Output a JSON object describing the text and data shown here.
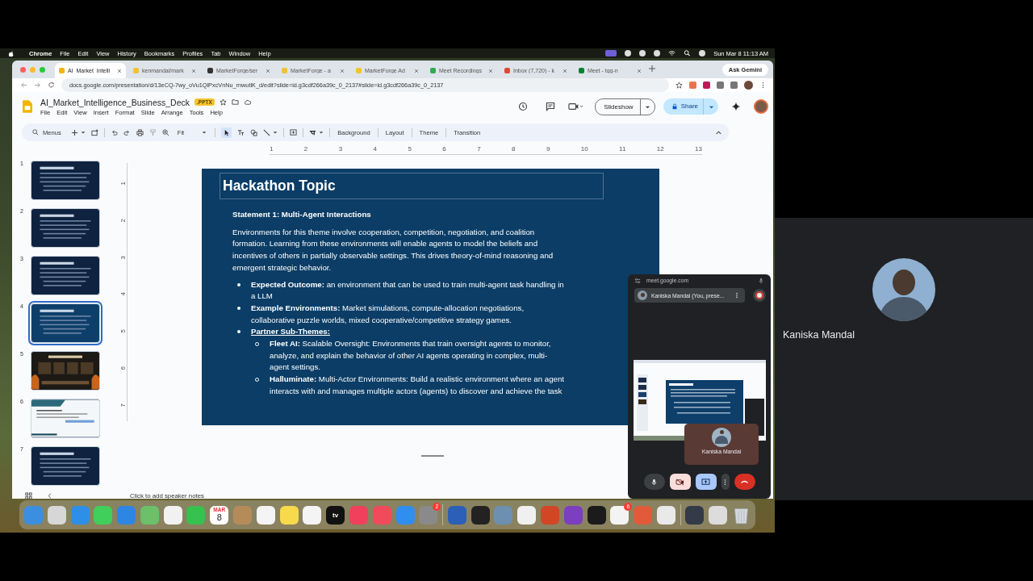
{
  "menubar": {
    "app": "Chrome",
    "menus": [
      "File",
      "Edit",
      "View",
      "History",
      "Bookmarks",
      "Profiles",
      "Tab",
      "Window",
      "Help"
    ],
    "clock": "Sun Mar 8  11:13 AM"
  },
  "tabs": [
    {
      "label": "AI_Market_Intelli",
      "selected": true
    },
    {
      "label": "kenmandal/mark",
      "selected": false
    },
    {
      "label": "MarketForge/ser",
      "selected": false
    },
    {
      "label": "MarketForge - a",
      "selected": false
    },
    {
      "label": "MarketForge Ad",
      "selected": false
    },
    {
      "label": "Meet Recordings",
      "selected": false
    },
    {
      "label": "Inbox (7,720) - k",
      "selected": false
    },
    {
      "label": "Meet - tqg-n",
      "selected": false
    }
  ],
  "ask_gemini": "Ask Gemini",
  "url": "docs.google.com/presentation/d/13eCQ-7wy_oVu1QlPxcVnNu_rnwutlK_d/edit?slide=id.g3cdf266a39c_0_2137#slide=id.g3cdf266a39c_0_2137",
  "doc": {
    "title": "AI_Market_Intelligence_Business_Deck",
    "badge": ".PPTX",
    "menus": [
      "File",
      "Edit",
      "View",
      "Insert",
      "Format",
      "Slide",
      "Arrange",
      "Tools",
      "Help"
    ]
  },
  "header_buttons": {
    "slideshow": "Slideshow",
    "share": "Share"
  },
  "toolbar": {
    "search": "Menus",
    "zoom": "Fit",
    "actions": [
      "Background",
      "Layout",
      "Theme",
      "Transition"
    ]
  },
  "ruler": {
    "h": [
      "1",
      "2",
      "3",
      "4",
      "5",
      "6",
      "7",
      "8",
      "9",
      "10",
      "11",
      "12",
      "13"
    ],
    "v": [
      "1",
      "2",
      "3",
      "4",
      "5",
      "6",
      "7"
    ]
  },
  "thumbnails": [
    {
      "number": "1",
      "selected": false,
      "kind": "dark"
    },
    {
      "number": "2",
      "selected": false,
      "kind": "dark"
    },
    {
      "number": "3",
      "selected": false,
      "kind": "dark"
    },
    {
      "number": "4",
      "selected": true,
      "kind": "blue"
    },
    {
      "number": "5",
      "selected": false,
      "kind": "image"
    },
    {
      "number": "6",
      "selected": false,
      "kind": "light"
    },
    {
      "number": "7",
      "selected": false,
      "kind": "dark"
    }
  ],
  "slide": {
    "title": "Hackathon Topic",
    "subtitle": "Statement 1: Multi-Agent Interactions",
    "intro": "Environments for this theme involve cooperation, competition, negotiation, and coalition formation. Learning from these environments will enable agents to model the beliefs and incentives of others in partially observable settings. This drives theory-of-mind reasoning and emergent strategic behavior.",
    "bullets": [
      {
        "kind": "item",
        "text": "**Expected Outcome:** an environment that can be used to train multi-agent task handling in a LLM"
      },
      {
        "kind": "item",
        "text": "**Example Environments:** Market simulations, compute-allocation negotiations, collaborative puzzle worlds, mixed cooperative/competitive strategy games."
      },
      {
        "kind": "heading",
        "text": "Partner Sub-Themes:",
        "children": [
          {
            "text": "**Fleet AI:** Scalable Oversight: Environments that train oversight agents to monitor, analyze, and explain the behavior of other AI agents operating in complex, multi-agent settings."
          },
          {
            "text": "**Halluminate:** Multi-Actor Environments: Build a realistic environment where an agent interacts with and manages multiple actors (agents) to discover and achieve the task"
          }
        ]
      }
    ]
  },
  "notes_placeholder": "Click to add speaker notes",
  "meet_popup": {
    "domain": "meet.google.com",
    "presenter": "Kaniska Mandal (You, prese...",
    "self_name": "Kaniska Mandal",
    "camera_on": false
  },
  "participant": {
    "name": "Kaniska Mandal"
  },
  "dock": [
    {
      "kind": "finder"
    },
    {
      "kind": "grid"
    },
    {
      "kind": "compass"
    },
    {
      "kind": "messages"
    },
    {
      "kind": "mail"
    },
    {
      "kind": "maps"
    },
    {
      "kind": "photos"
    },
    {
      "kind": "video"
    },
    {
      "kind": "calendar",
      "month": "MAR",
      "day": "8"
    },
    {
      "kind": "contacts"
    },
    {
      "kind": "list"
    },
    {
      "kind": "notes"
    },
    {
      "kind": "freeform"
    },
    {
      "kind": "tv",
      "label": "tv"
    },
    {
      "kind": "music"
    },
    {
      "kind": "news"
    },
    {
      "kind": "store"
    },
    {
      "kind": "settings",
      "badge": "2"
    },
    {
      "kind": "separator"
    },
    {
      "kind": "word"
    },
    {
      "kind": "cube"
    },
    {
      "kind": "preview"
    },
    {
      "kind": "textedit"
    },
    {
      "kind": "powerpoint"
    },
    {
      "kind": "github"
    },
    {
      "kind": "terminal"
    },
    {
      "kind": "office",
      "badge": "6"
    },
    {
      "kind": "burst"
    },
    {
      "kind": "chrome"
    },
    {
      "kind": "separator"
    },
    {
      "kind": "window"
    },
    {
      "kind": "doc"
    },
    {
      "kind": "trash"
    }
  ]
}
